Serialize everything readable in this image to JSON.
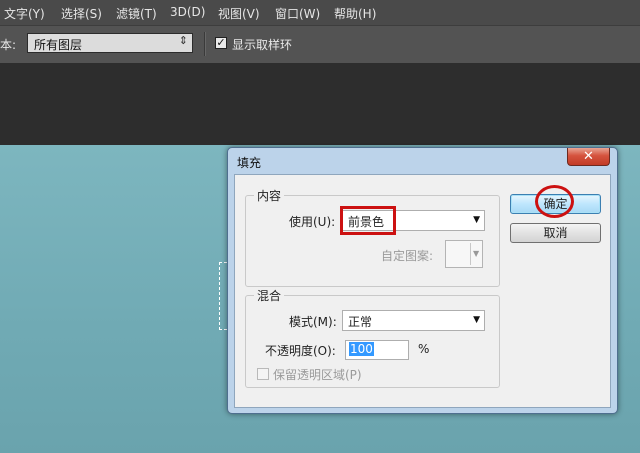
{
  "menu": {
    "items": [
      "文字(Y)",
      "选择(S)",
      "滤镜(T)",
      "3D(D)",
      "视图(V)",
      "窗口(W)",
      "帮助(H)"
    ]
  },
  "options_bar": {
    "sample_label": "本:",
    "sample_value": "所有图层",
    "show_ring_label": "显示取样环",
    "show_ring_checked": true
  },
  "dialog": {
    "title": "填充",
    "close_glyph": "✕",
    "content_group": {
      "title": "内容",
      "use_label": "使用(U):",
      "use_value": "前景色",
      "custom_pattern_label": "自定图案:"
    },
    "blend_group": {
      "title": "混合",
      "mode_label": "模式(M):",
      "mode_value": "正常",
      "opacity_label": "不透明度(O):",
      "opacity_value": "100",
      "opacity_unit": "%",
      "preserve_label": "保留透明区域(P)",
      "preserve_checked": false
    },
    "ok_label": "确定",
    "cancel_label": "取消"
  },
  "colors": {
    "menubar": "#4a4a4a",
    "optbar": "#535353",
    "canvas": "#70aab4",
    "annotation_red": "#cc1111"
  }
}
